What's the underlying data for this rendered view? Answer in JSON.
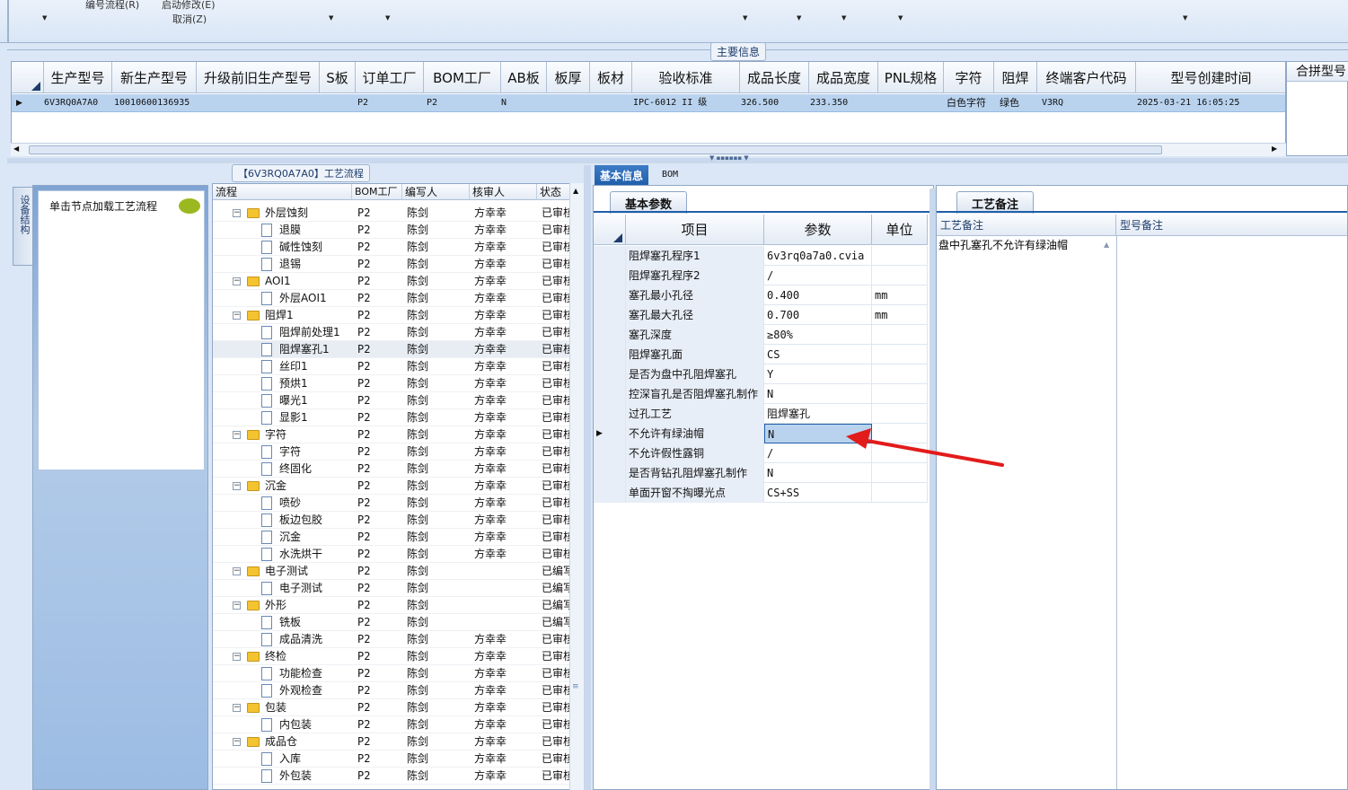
{
  "toolbar": {
    "menu_numbering_flow": "编号流程(R)",
    "menu_start_modify": "启动修改(E)",
    "menu_cancel": "取消(Z)"
  },
  "main_info": {
    "group_title": "主要信息",
    "columns": [
      "生产型号",
      "新生产型号",
      "升级前旧生产型号",
      "S板",
      "订单工厂",
      "BOM工厂",
      "AB板",
      "板厚",
      "板材",
      "验收标准",
      "成品长度",
      "成品宽度",
      "PNL规格",
      "字符",
      "阻焊",
      "终端客户代码",
      "型号创建时间"
    ],
    "row": {
      "model": "6V3RQ0A7A0",
      "new_model": "10010600136935",
      "old_model": "",
      "s_board": "",
      "order_factory": "P2",
      "bom_factory": "P2",
      "ab_board": "N",
      "thickness": "",
      "material": "",
      "standard": "IPC-6012 II 级",
      "length": "326.500",
      "width": "233.350",
      "pnl": "",
      "char": "白色字符",
      "solder_mask": "绿色",
      "customer_code": "V3RQ",
      "created": "2025-03-21 16:05:25"
    },
    "merge_panel_title": "合拼型号"
  },
  "left_panel": {
    "vertical_tab": "设备结构",
    "hint": "单击节点加载工艺流程"
  },
  "flow_tree": {
    "title": "【6V3RQ0A7A0】工艺流程",
    "headers": [
      "流程",
      "BOM工厂",
      "编写人",
      "核审人",
      "状态"
    ],
    "rows": [
      {
        "name": "外层蚀刻",
        "type": "folder",
        "bom": "P2",
        "author": "陈剑",
        "reviewer": "方幸幸",
        "status": "已审核"
      },
      {
        "name": "退膜",
        "type": "doc",
        "bom": "P2",
        "author": "陈剑",
        "reviewer": "方幸幸",
        "status": "已审核"
      },
      {
        "name": "碱性蚀刻",
        "type": "doc",
        "bom": "P2",
        "author": "陈剑",
        "reviewer": "方幸幸",
        "status": "已审核"
      },
      {
        "name": "退锡",
        "type": "doc",
        "bom": "P2",
        "author": "陈剑",
        "reviewer": "方幸幸",
        "status": "已审核"
      },
      {
        "name": "AOI1",
        "type": "folder",
        "bom": "P2",
        "author": "陈剑",
        "reviewer": "方幸幸",
        "status": "已审核"
      },
      {
        "name": "外层AOI1",
        "type": "doc",
        "bom": "P2",
        "author": "陈剑",
        "reviewer": "方幸幸",
        "status": "已审核"
      },
      {
        "name": "阻焊1",
        "type": "folder",
        "bom": "P2",
        "author": "陈剑",
        "reviewer": "方幸幸",
        "status": "已审核"
      },
      {
        "name": "阻焊前处理1",
        "type": "doc",
        "bom": "P2",
        "author": "陈剑",
        "reviewer": "方幸幸",
        "status": "已审核"
      },
      {
        "name": "阻焊塞孔1",
        "type": "doc",
        "bom": "P2",
        "author": "陈剑",
        "reviewer": "方幸幸",
        "status": "已审核",
        "selected": true
      },
      {
        "name": "丝印1",
        "type": "doc",
        "bom": "P2",
        "author": "陈剑",
        "reviewer": "方幸幸",
        "status": "已审核"
      },
      {
        "name": "预烘1",
        "type": "doc",
        "bom": "P2",
        "author": "陈剑",
        "reviewer": "方幸幸",
        "status": "已审核"
      },
      {
        "name": "曝光1",
        "type": "doc",
        "bom": "P2",
        "author": "陈剑",
        "reviewer": "方幸幸",
        "status": "已审核"
      },
      {
        "name": "显影1",
        "type": "doc",
        "bom": "P2",
        "author": "陈剑",
        "reviewer": "方幸幸",
        "status": "已审核"
      },
      {
        "name": "字符",
        "type": "folder",
        "bom": "P2",
        "author": "陈剑",
        "reviewer": "方幸幸",
        "status": "已审核"
      },
      {
        "name": "字符",
        "type": "doc",
        "bom": "P2",
        "author": "陈剑",
        "reviewer": "方幸幸",
        "status": "已审核"
      },
      {
        "name": "终固化",
        "type": "doc",
        "bom": "P2",
        "author": "陈剑",
        "reviewer": "方幸幸",
        "status": "已审核"
      },
      {
        "name": "沉金",
        "type": "folder",
        "bom": "P2",
        "author": "陈剑",
        "reviewer": "方幸幸",
        "status": "已审核"
      },
      {
        "name": "喷砂",
        "type": "doc",
        "bom": "P2",
        "author": "陈剑",
        "reviewer": "方幸幸",
        "status": "已审核"
      },
      {
        "name": "板边包胶",
        "type": "doc",
        "bom": "P2",
        "author": "陈剑",
        "reviewer": "方幸幸",
        "status": "已审核"
      },
      {
        "name": "沉金",
        "type": "doc",
        "bom": "P2",
        "author": "陈剑",
        "reviewer": "方幸幸",
        "status": "已审核"
      },
      {
        "name": "水洗烘干",
        "type": "doc",
        "bom": "P2",
        "author": "陈剑",
        "reviewer": "方幸幸",
        "status": "已审核"
      },
      {
        "name": "电子测试",
        "type": "folder",
        "bom": "P2",
        "author": "陈剑",
        "reviewer": "",
        "status": "已编写"
      },
      {
        "name": "电子测试",
        "type": "doc",
        "bom": "P2",
        "author": "陈剑",
        "reviewer": "",
        "status": "已编写"
      },
      {
        "name": "外形",
        "type": "folder",
        "bom": "P2",
        "author": "陈剑",
        "reviewer": "",
        "status": "已编写"
      },
      {
        "name": "铣板",
        "type": "doc",
        "bom": "P2",
        "author": "陈剑",
        "reviewer": "",
        "status": "已编写"
      },
      {
        "name": "成品清洗",
        "type": "doc",
        "bom": "P2",
        "author": "陈剑",
        "reviewer": "方幸幸",
        "status": "已审核"
      },
      {
        "name": "终检",
        "type": "folder",
        "bom": "P2",
        "author": "陈剑",
        "reviewer": "方幸幸",
        "status": "已审核"
      },
      {
        "name": "功能检查",
        "type": "doc",
        "bom": "P2",
        "author": "陈剑",
        "reviewer": "方幸幸",
        "status": "已审核"
      },
      {
        "name": "外观检查",
        "type": "doc",
        "bom": "P2",
        "author": "陈剑",
        "reviewer": "方幸幸",
        "status": "已审核"
      },
      {
        "name": "包装",
        "type": "folder",
        "bom": "P2",
        "author": "陈剑",
        "reviewer": "方幸幸",
        "status": "已审核"
      },
      {
        "name": "内包装",
        "type": "doc",
        "bom": "P2",
        "author": "陈剑",
        "reviewer": "方幸幸",
        "status": "已审核"
      },
      {
        "name": "成品仓",
        "type": "folder",
        "bom": "P2",
        "author": "陈剑",
        "reviewer": "方幸幸",
        "status": "已审核"
      },
      {
        "name": "入库",
        "type": "doc",
        "bom": "P2",
        "author": "陈剑",
        "reviewer": "方幸幸",
        "status": "已审核"
      },
      {
        "name": "外包装",
        "type": "doc",
        "bom": "P2",
        "author": "陈剑",
        "reviewer": "方幸幸",
        "status": "已审核"
      }
    ]
  },
  "tabs": {
    "basic_info": "基本信息",
    "bom": "BOM"
  },
  "basic_params": {
    "subtab": "基本参数",
    "headers": [
      "项目",
      "参数",
      "单位"
    ],
    "rows": [
      {
        "item": "阻焊塞孔程序1",
        "value": "6v3rq0a7a0.cvia",
        "unit": ""
      },
      {
        "item": "阻焊塞孔程序2",
        "value": "/",
        "unit": ""
      },
      {
        "item": "塞孔最小孔径",
        "value": "0.400",
        "unit": "mm"
      },
      {
        "item": "塞孔最大孔径",
        "value": "0.700",
        "unit": "mm"
      },
      {
        "item": "塞孔深度",
        "value": "≥80%",
        "unit": ""
      },
      {
        "item": "阻焊塞孔面",
        "value": "CS",
        "unit": ""
      },
      {
        "item": "是否为盘中孔阻焊塞孔",
        "value": "Y",
        "unit": ""
      },
      {
        "item": "控深盲孔是否阻焊塞孔制作",
        "value": "N",
        "unit": ""
      },
      {
        "item": "过孔工艺",
        "value": "阻焊塞孔",
        "unit": ""
      },
      {
        "item": "不允许有绿油帽",
        "value": "N",
        "unit": "",
        "current": true
      },
      {
        "item": "不允许假性露铜",
        "value": "/",
        "unit": ""
      },
      {
        "item": "是否背钻孔阻焊塞孔制作",
        "value": "N",
        "unit": ""
      },
      {
        "item": "单面开窗不掏曝光点",
        "value": "CS+SS",
        "unit": ""
      }
    ]
  },
  "remarks": {
    "subtab": "工艺备注",
    "process_header": "工艺备注",
    "model_header": "型号备注",
    "process_text": "盘中孔塞孔不允许有绿油帽"
  },
  "colors": {
    "selection": "#b9d3ef",
    "annotation_arrow": "#e21b1b",
    "accent": "#1f5ea8"
  }
}
